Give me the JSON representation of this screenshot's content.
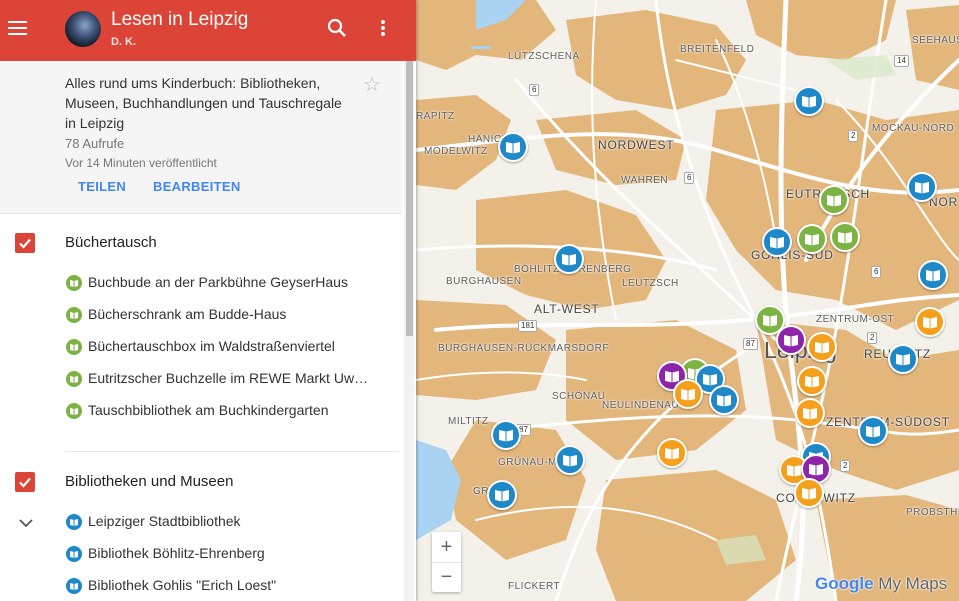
{
  "header": {
    "title": "Lesen in Leipzig",
    "author": "D. K."
  },
  "info": {
    "description": "Alles rund ums Kinderbuch: Bibliotheken, Museen, Buchhandlungen und Tauschregale in Leipzig",
    "views": "78 Aufrufe",
    "published": "Vor 14 Minuten veröffentlicht",
    "share_label": "TEILEN",
    "edit_label": "BEARBEITEN"
  },
  "layers": [
    {
      "title": "Büchertausch",
      "color": "#7cb342",
      "items": [
        "Buchbude an der Parkbühne GeyserHaus",
        "Bücherschrank am Budde-Haus",
        "Büchertauschbox im Waldstraßenviertel",
        "Eutritzscher Buchzelle im REWE Markt Uwe ...",
        "Tauschbibliothek am Buchkindergarten"
      ]
    },
    {
      "title": "Bibliotheken und Museen",
      "color": "#1e88c9",
      "items": [
        "Leipziger Stadtbibliothek",
        "Bibliothek Böhlitz-Ehrenberg",
        "Bibliothek Gohlis \"Erich Loest\""
      ]
    }
  ],
  "map": {
    "labels": {
      "luetzschena": "LÜTZSCHENA",
      "breitenfeld": "BREITENFELD",
      "seehausen": "SEEHAUSEN",
      "hanichen": "HÄNICH",
      "rapitz": "RAPITZ",
      "modelwitz": "MODELWITZ",
      "nordwest": "NORDWEST",
      "wahren": "WAHREN",
      "mockau": "MOCKAU-NORD",
      "eutritzsch": "EUTRITZSCH",
      "nor": "NOR",
      "gohlis": "GOHLIS-SÜD",
      "boehlitz": "BÖHLITZ-EHRENBERG",
      "burghausen": "BURGHAUSEN",
      "leutzsch": "LEUTZSCH",
      "altwest": "ALT-WEST",
      "zentrumost": "ZENTRUM-OST",
      "leipzig": "Leipzig",
      "burgrueck": "BURGHAUSEN-RÜCKMARSDORF",
      "reudnitz": "REUDNITZ",
      "schoenau": "SCHÖNAU",
      "neulindenau": "NEULINDENAU",
      "miltitz": "MILTITZ",
      "zentrumsuedost": "ZENTRUM-SÜDOST",
      "gruenau": "GRÜNAU-MI",
      "gruenauvorn": "GR",
      "connewitz": "CONNEWITZ",
      "probstheida": "PROBSTHEID",
      "flickert": "FLICKERT"
    },
    "shields": {
      "s6a": "6",
      "s14": "14",
      "s2a": "2",
      "s6b": "6",
      "s6c": "6",
      "s181": "181",
      "s87a": "87",
      "s2b": "2",
      "s87b": "87",
      "s2c": "2"
    },
    "zoom_in": "+",
    "zoom_out": "−",
    "brand_google": "Google",
    "brand_mymaps": "My Maps"
  },
  "colors": {
    "header": "#db4437",
    "accent": "#4285f4",
    "marker_blue": "#1e88c9",
    "marker_green": "#7cb342",
    "marker_orange": "#f4a01c",
    "marker_purple": "#8e24aa",
    "map_urban": "#e3b67c",
    "map_background": "#f4f1ea",
    "map_water": "#aad3f2"
  },
  "icons": {
    "menu": "menu-icon",
    "search": "search-icon",
    "more": "more-vert-icon",
    "star": "star-outline-icon",
    "check": "check-icon",
    "expand": "chevron-down-icon",
    "book": "book-icon"
  }
}
